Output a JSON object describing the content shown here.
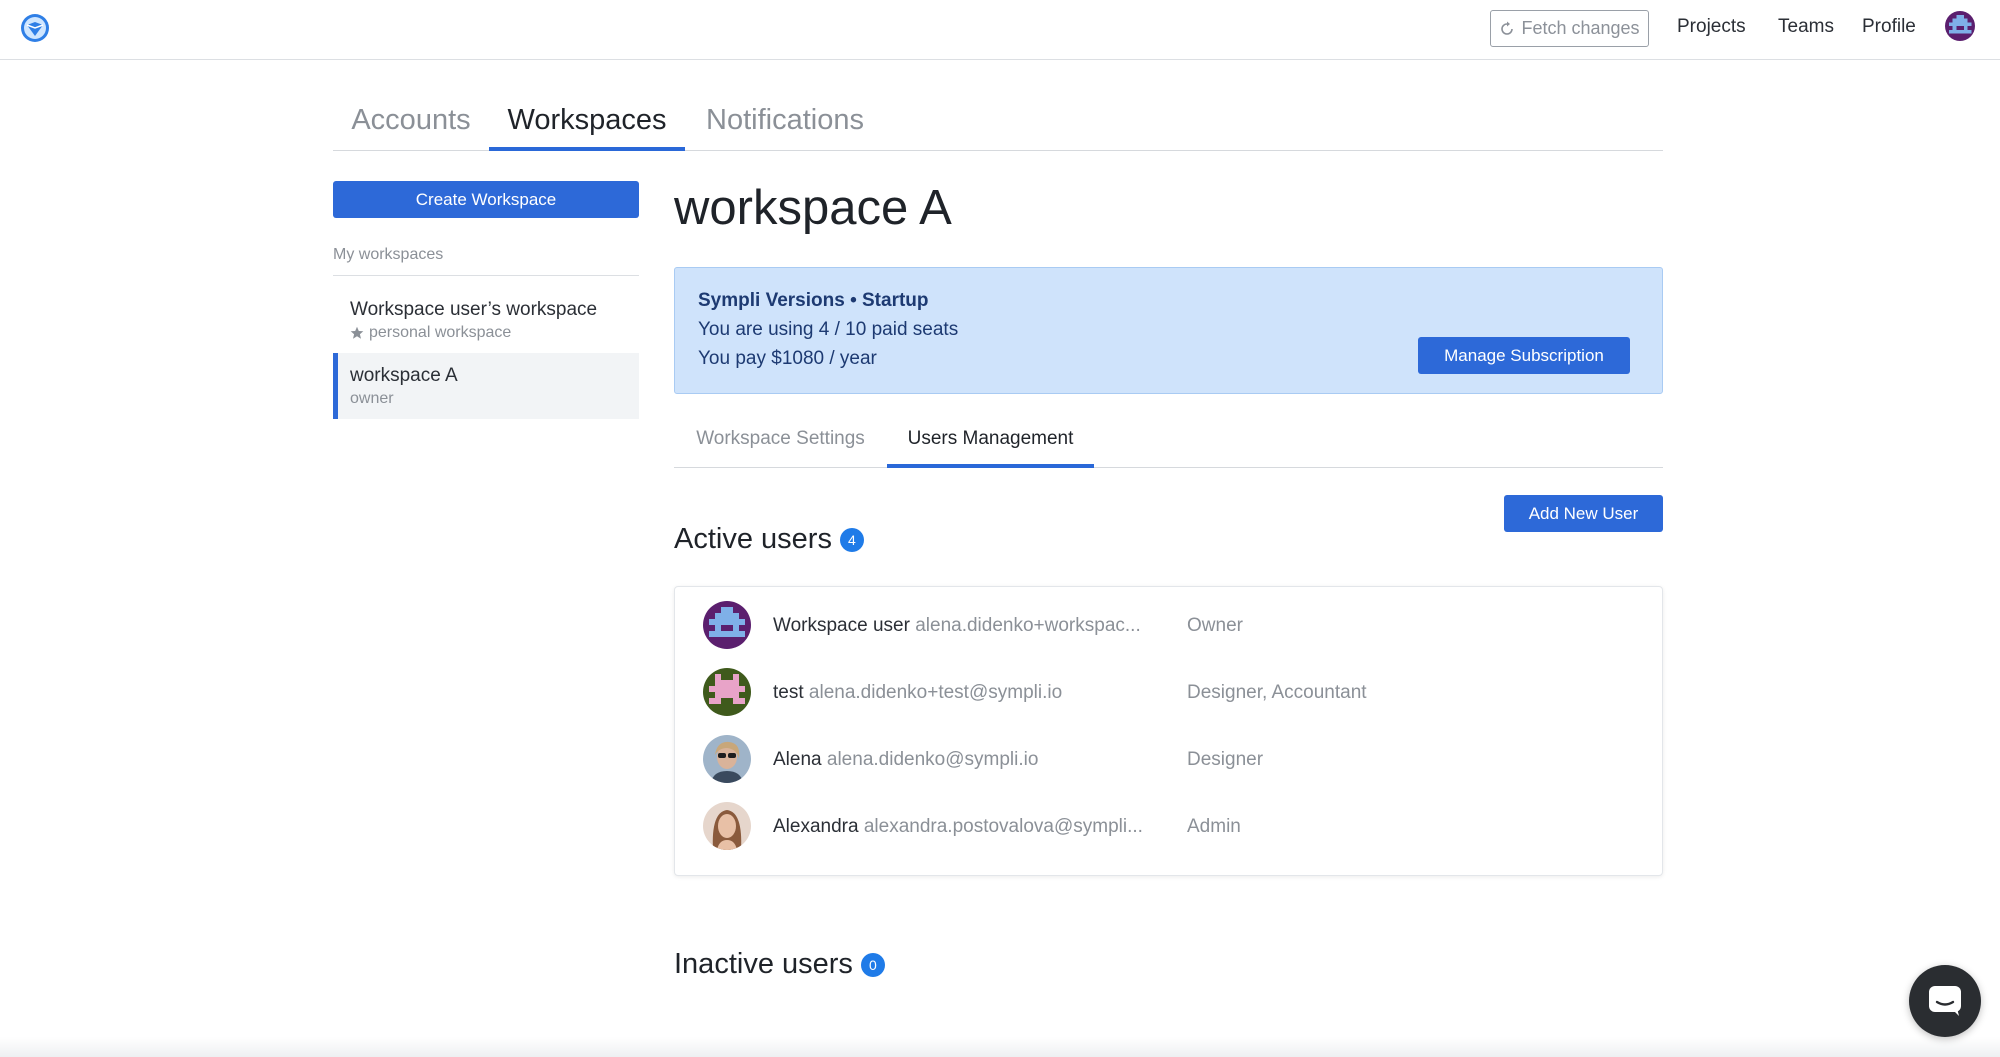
{
  "header": {
    "fetch_label": "Fetch changes",
    "nav": [
      "Projects",
      "Teams",
      "Profile"
    ]
  },
  "main_tabs": [
    "Accounts",
    "Workspaces",
    "Notifications"
  ],
  "sidebar": {
    "create_label": "Create Workspace",
    "section_label": "My workspaces",
    "workspaces": [
      {
        "name": "Workspace user’s workspace",
        "sub": "personal workspace"
      },
      {
        "name": "workspace A",
        "sub": "owner"
      }
    ]
  },
  "workspace": {
    "title": "workspace A",
    "plan": {
      "title": "Sympli Versions • Startup",
      "seats": "You are using 4 / 10 paid seats",
      "price": "You pay $1080 / year",
      "manage_label": "Manage Subscription"
    },
    "sub_tabs": [
      "Workspace Settings",
      "Users Management"
    ],
    "add_user_label": "Add New User",
    "active_title": "Active users",
    "active_count": "4",
    "inactive_title": "Inactive users",
    "inactive_count": "0",
    "users": [
      {
        "name": "Workspace user",
        "email": "alena.didenko+workspac...",
        "role": "Owner"
      },
      {
        "name": "test",
        "email": "alena.didenko+test@sympli.io",
        "role": "Designer, Accountant"
      },
      {
        "name": "Alena",
        "email": "alena.didenko@sympli.io",
        "role": "Designer"
      },
      {
        "name": "Alexandra",
        "email": "alexandra.postovalova@sympli...",
        "role": "Admin"
      }
    ]
  },
  "colors": {
    "accent": "#2d69d8",
    "plan_bg": "#cfe3fb",
    "badge": "#1f7be8"
  },
  "icons": {
    "logo": "sympli-logo-icon",
    "fetch": "refresh-icon",
    "star": "star-icon",
    "chat": "chat-icon"
  }
}
